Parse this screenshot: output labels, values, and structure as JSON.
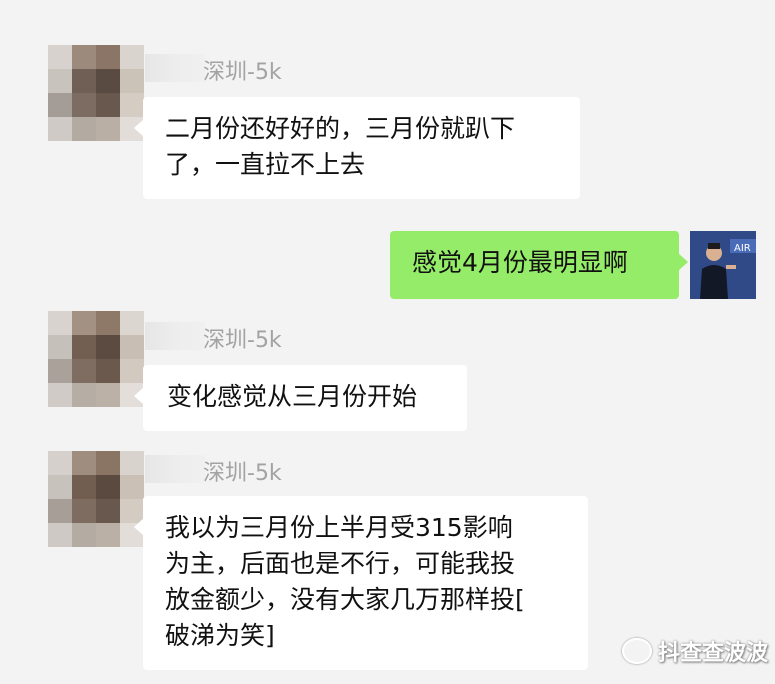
{
  "messages": [
    {
      "sender": "深圳-5k",
      "text": "二月份还好好的，三月份就趴下了，一直拉不上去",
      "line1": "二月份还好好的，三月份就趴下",
      "line2": "了，一直拉不上去"
    },
    {
      "sender": "self",
      "text": "感觉4月份最明显啊"
    },
    {
      "sender": "深圳-5k",
      "text": "变化感觉从三月份开始"
    },
    {
      "sender": "深圳-5k",
      "lines": [
        "我以为三月份上半月受315影响",
        "为主，后面也是不行，可能我投",
        "放金额少，没有大家几万那样投[",
        "破涕为笑]"
      ]
    }
  ],
  "watermark": "抖查查波波",
  "colors": {
    "background": "#f3f3f3",
    "incoming_bubble": "#ffffff",
    "outgoing_bubble": "#95ec69",
    "name": "#a3a3a3"
  }
}
